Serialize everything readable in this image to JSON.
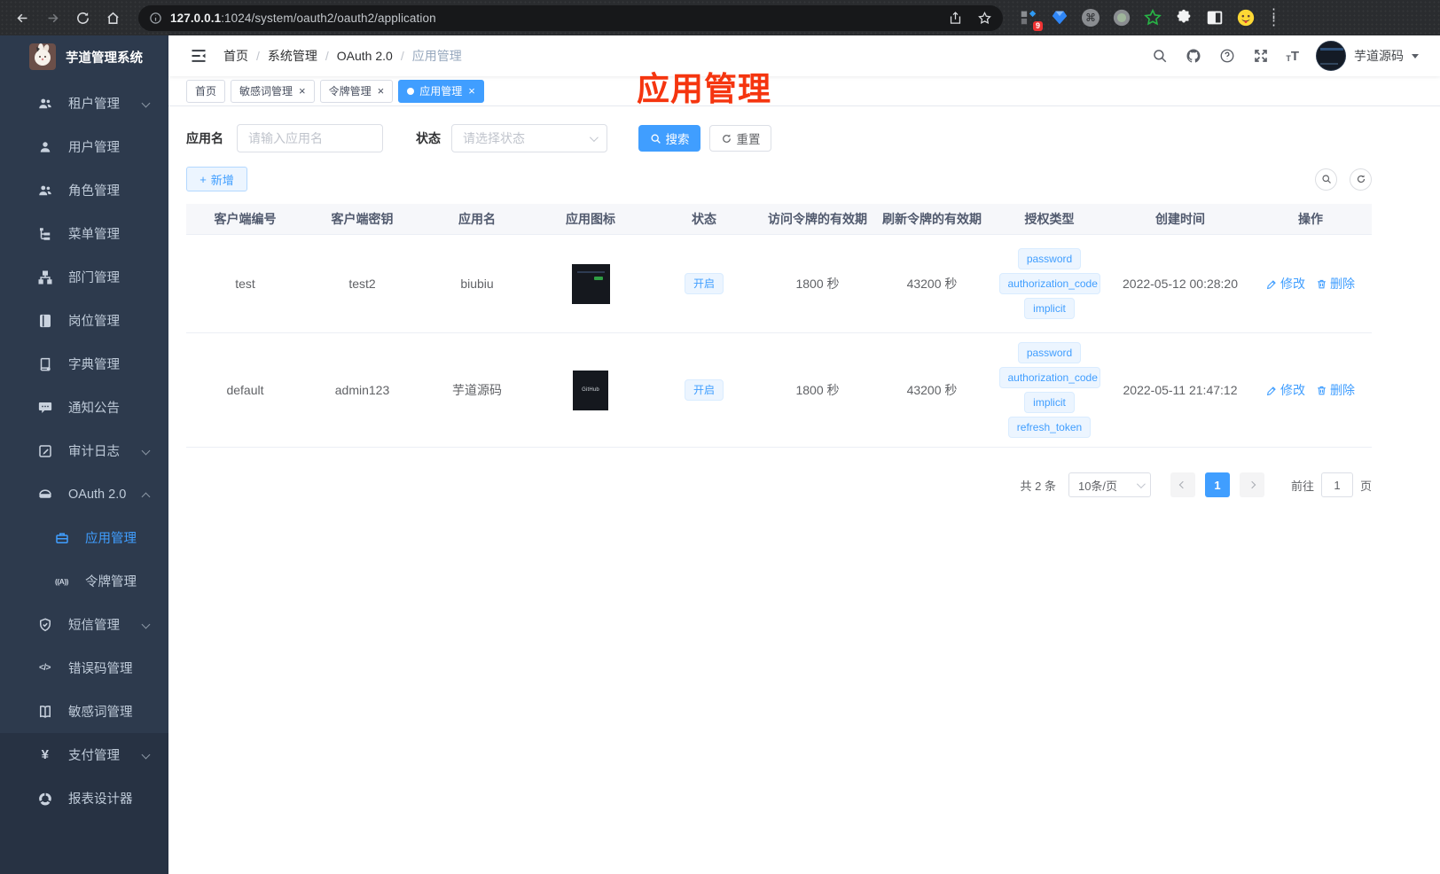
{
  "browser": {
    "url_host": "127.0.0.1",
    "url_rest": ":1024/system/oauth2/oauth2/application",
    "ext_badge": "9"
  },
  "sidebar": {
    "app_title": "芋道管理系统",
    "items": [
      {
        "key": "tenant",
        "label": "租户管理",
        "icon": "tenant",
        "chevron": "down"
      },
      {
        "key": "user",
        "label": "用户管理",
        "icon": "user"
      },
      {
        "key": "role",
        "label": "角色管理",
        "icon": "role"
      },
      {
        "key": "menu",
        "label": "菜单管理",
        "icon": "menu"
      },
      {
        "key": "dept",
        "label": "部门管理",
        "icon": "dept"
      },
      {
        "key": "post",
        "label": "岗位管理",
        "icon": "post"
      },
      {
        "key": "dict",
        "label": "字典管理",
        "icon": "dict"
      },
      {
        "key": "notice",
        "label": "通知公告",
        "icon": "notice"
      },
      {
        "key": "audit-log",
        "label": "审计日志",
        "icon": "log",
        "chevron": "down"
      },
      {
        "key": "oauth2",
        "label": "OAuth 2.0",
        "icon": "oauth",
        "chevron": "up"
      },
      {
        "key": "oauth2-app",
        "label": "应用管理",
        "icon": "app",
        "sub": true,
        "active": true
      },
      {
        "key": "oauth2-token",
        "label": "令牌管理",
        "icon": "token",
        "sub": true
      },
      {
        "key": "sms",
        "label": "短信管理",
        "icon": "sms",
        "chevron": "down"
      },
      {
        "key": "errcode",
        "label": "错误码管理",
        "icon": "errcode"
      },
      {
        "key": "sensitive",
        "label": "敏感词管理",
        "icon": "sensitive"
      },
      {
        "key": "pay",
        "label": "支付管理",
        "icon": "pay",
        "chevron": "down",
        "section": "lower"
      },
      {
        "key": "report",
        "label": "报表设计器",
        "icon": "report",
        "section": "lower"
      }
    ]
  },
  "header": {
    "breadcrumb": [
      "首页",
      "系统管理",
      "OAuth 2.0",
      "应用管理"
    ],
    "username": "芋道源码"
  },
  "tabs": [
    {
      "key": "home",
      "label": "首页"
    },
    {
      "key": "sensitive",
      "label": "敏感词管理",
      "closable": true
    },
    {
      "key": "token",
      "label": "令牌管理",
      "closable": true
    },
    {
      "key": "app",
      "label": "应用管理",
      "closable": true,
      "active": true
    }
  ],
  "overlay_title": "应用管理",
  "filters": {
    "name_label": "应用名",
    "name_placeholder": "请输入应用名",
    "status_label": "状态",
    "status_placeholder": "请选择状态",
    "search_label": "搜索",
    "reset_label": "重置"
  },
  "toolbar": {
    "add_label": "新增"
  },
  "table": {
    "headers": [
      "客户端编号",
      "客户端密钥",
      "应用名",
      "应用图标",
      "状态",
      "访问令牌的有效期",
      "刷新令牌的有效期",
      "授权类型",
      "创建时间",
      "操作"
    ],
    "edit_label": "修改",
    "delete_label": "删除",
    "rows": [
      {
        "client_id": "test",
        "client_secret": "test2",
        "name": "biubiu",
        "icon": "screenshot",
        "status": "开启",
        "access_token_validity": "1800 秒",
        "refresh_token_validity": "43200 秒",
        "grant_types": [
          "password",
          "authorization_code",
          "implicit"
        ],
        "create_time": "2022-05-12 00:28:20"
      },
      {
        "client_id": "default",
        "client_secret": "admin123",
        "name": "芋道源码",
        "icon": "github",
        "github_label": "GitHub",
        "status": "开启",
        "access_token_validity": "1800 秒",
        "refresh_token_validity": "43200 秒",
        "grant_types": [
          "password",
          "authorization_code",
          "implicit",
          "refresh_token"
        ],
        "create_time": "2022-05-11 21:47:12"
      }
    ]
  },
  "pagination": {
    "total": "共 2 条",
    "page_size": "10条/页",
    "current": "1",
    "goto_prefix": "前往",
    "goto_value": "1",
    "goto_suffix": "页"
  },
  "colors": {
    "accent": "#409eff",
    "sidebar_bg": "#2d3a4d",
    "sidebar_lower_bg": "#273243",
    "tag_bg": "#ecf5ff",
    "tag_border": "#d9ecff",
    "overlay_red": "#f5350f"
  }
}
